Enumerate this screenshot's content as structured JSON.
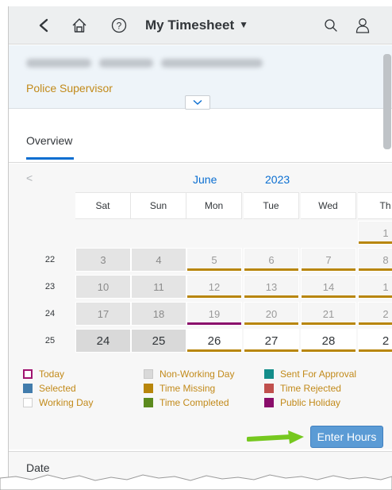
{
  "header": {
    "title": "My Timesheet",
    "icons": [
      "back-icon",
      "home-icon",
      "help-icon",
      "search-icon",
      "user-icon"
    ]
  },
  "employee": {
    "role": "Police Supervisor"
  },
  "tabs": [
    {
      "label": "Overview",
      "selected": true
    }
  ],
  "calendar": {
    "month": "June",
    "year": "2023",
    "weekday_headers": [
      "Sat",
      "Sun",
      "Mon",
      "Tue",
      "Wed",
      "Th"
    ],
    "weeks": [
      {
        "week": "",
        "days": [
          "",
          "",
          "",
          "",
          "",
          "1"
        ]
      },
      {
        "week": "22",
        "days": [
          "3",
          "4",
          "5",
          "6",
          "7",
          "8"
        ]
      },
      {
        "week": "23",
        "days": [
          "10",
          "11",
          "12",
          "13",
          "14",
          "1"
        ]
      },
      {
        "week": "24",
        "days": [
          "17",
          "18",
          "19",
          "20",
          "21",
          "2"
        ]
      },
      {
        "week": "25",
        "days": [
          "24",
          "25",
          "26",
          "27",
          "28",
          "2"
        ]
      }
    ]
  },
  "legend": {
    "today": "Today",
    "selected": "Selected",
    "working_day": "Working Day",
    "non_working_day": "Non-Working Day",
    "time_missing": "Time Missing",
    "time_completed": "Time Completed",
    "sent_for_approval": "Sent For Approval",
    "time_rejected": "Time Rejected",
    "public_holiday": "Public Holiday"
  },
  "colors": {
    "today": "#a0136f",
    "selected": "#427cac",
    "working_day": "#ffffff",
    "non_working_day": "#d9d9d9",
    "time_missing": "#b8860b",
    "time_completed": "#5c8a1e",
    "sent_for_approval": "#138d8a",
    "time_rejected": "#c0504d",
    "public_holiday": "#8a0d6b",
    "accent": "#0a6ed1"
  },
  "actions": {
    "enter_hours": "Enter Hours"
  },
  "details": {
    "date_label": "Date"
  }
}
